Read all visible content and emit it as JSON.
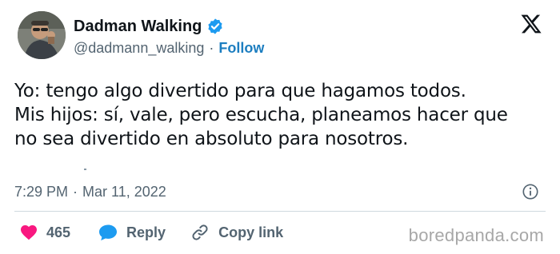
{
  "author": {
    "display_name": "Dadman Walking",
    "handle": "@dadmann_walking",
    "separator": "·",
    "follow_label": "Follow",
    "verified": true,
    "verified_color": "#1d9bf0"
  },
  "tweet": {
    "lines": [
      "Yo: tengo algo divertido para que hagamos todos.",
      "Mis hijos: sí, vale, pero escucha, planeamos hacer que",
      "no sea divertido en absoluto para nosotros."
    ],
    "time": "7:29 PM",
    "separator": "·",
    "date": "Mar 11, 2022"
  },
  "actions": {
    "like_count": "465",
    "reply_label": "Reply",
    "copy_link_label": "Copy link",
    "like_color": "#f91880",
    "reply_color": "#1d9bf0"
  },
  "icons": {
    "platform_logo": "x-logo-icon",
    "verified": "verified-badge-icon",
    "info": "info-icon",
    "like": "heart-icon",
    "reply": "speech-bubble-icon",
    "copy_link": "link-icon"
  },
  "watermark": "boredpanda.com"
}
